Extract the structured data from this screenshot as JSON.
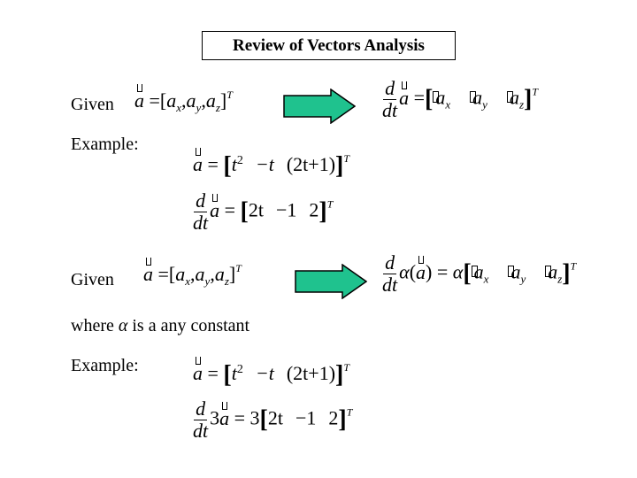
{
  "title": "Review of Vectors Analysis",
  "colors": {
    "arrow_fill": "#1fc28e",
    "arrow_stroke": "#000000"
  },
  "section1": {
    "given_label": "Given",
    "vector_def": {
      "lhs": "a",
      "eq": "=",
      "open": "[",
      "components": [
        "a",
        "a",
        "a"
      ],
      "subs": [
        "x",
        "y",
        "z"
      ],
      "sep": ",",
      "close": "]",
      "transpose": "T"
    },
    "arrow_icon": "right-arrow-icon",
    "derivative": {
      "num": "d",
      "den": "dt",
      "vec": "a",
      "eq": "=",
      "components": [
        "a",
        "a",
        "a"
      ],
      "subs": [
        "x",
        "y",
        "z"
      ],
      "transpose": "T"
    },
    "example_label": "Example:",
    "example_vector": {
      "lhs": "a",
      "eq": "=",
      "c1": "t",
      "c1_exp": "2",
      "c2": "−t",
      "c3": "(2t+1)",
      "transpose": "T"
    },
    "example_derivative": {
      "num": "d",
      "den": "dt",
      "vec": "a",
      "eq": "=",
      "c1": "2t",
      "c2": "−1",
      "c3": "2",
      "transpose": "T"
    }
  },
  "section2": {
    "given_label": "Given",
    "vector_def": {
      "lhs": "a",
      "eq": "=",
      "open": "[",
      "components": [
        "a",
        "a",
        "a"
      ],
      "subs": [
        "x",
        "y",
        "z"
      ],
      "sep": ",",
      "close": "]",
      "transpose": "T"
    },
    "arrow_icon": "right-arrow-icon",
    "derivative": {
      "num": "d",
      "den": "dt",
      "alpha": "α",
      "vec": "a",
      "eq": "=",
      "components": [
        "a",
        "a",
        "a"
      ],
      "subs": [
        "x",
        "y",
        "z"
      ],
      "transpose": "T"
    },
    "where_text_1": "where",
    "where_alpha": "α",
    "where_text_2": "is a any constant",
    "example_label": "Example:",
    "example_vector": {
      "lhs": "a",
      "eq": "=",
      "c1": "t",
      "c1_exp": "2",
      "c2": "−t",
      "c3": "(2t+1)",
      "transpose": "T"
    },
    "example_derivative": {
      "num": "d",
      "den": "dt",
      "coef": "3",
      "vec": "a",
      "eq": "=",
      "c1": "2t",
      "c2": "−1",
      "c3": "2",
      "transpose": "T"
    }
  }
}
